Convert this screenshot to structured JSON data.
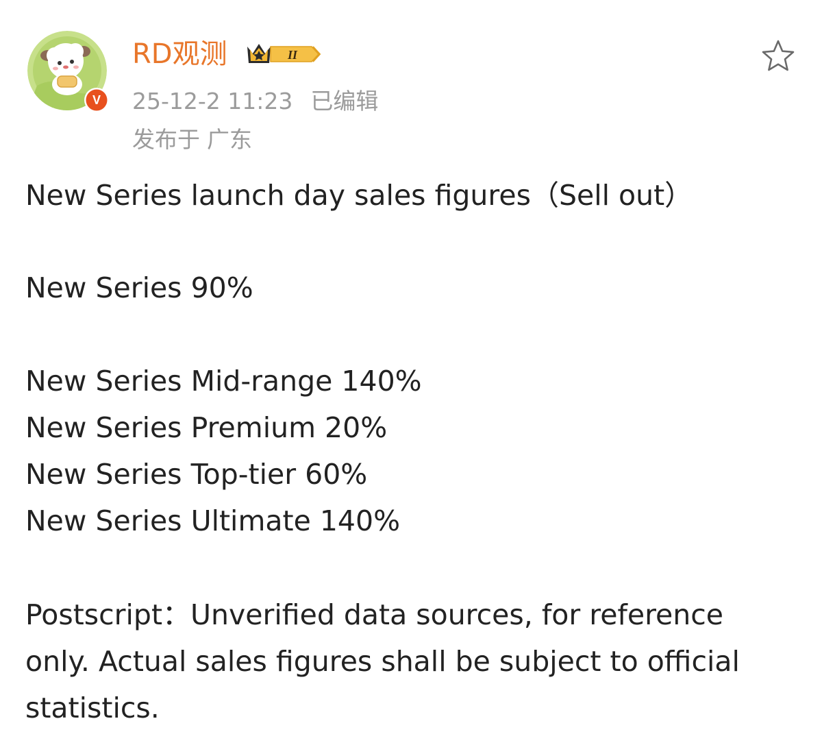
{
  "colors": {
    "username": "#e8762a",
    "meta": "#9b9b9b",
    "text": "#222222",
    "verified": "#e8501e",
    "badge_gold": "#f2b632"
  },
  "author": {
    "name": "RD观测",
    "avatar_icon": "sheep-avatar",
    "verified_icon": "verified-v-badge",
    "verified_letter": "V",
    "level_icon": "crown-level-badge",
    "level_label": "II"
  },
  "meta": {
    "timestamp": "25-12-2 11:23",
    "edited": "已编辑",
    "location_label": "发布于",
    "location_value": "广东"
  },
  "actions": {
    "favorite_icon": "star-outline-icon"
  },
  "content": {
    "headline": "New Series launch day sales figures（Sell out）",
    "overall": "New Series 90%",
    "items": [
      "New Series Mid-range 140%",
      "New Series Premium 20%",
      "New Series Top-tier 60%",
      "New Series Ultimate 140%"
    ],
    "postscript": [
      "Postscript：Unverified data sources, for reference",
      "only. Actual sales figures shall be subject to official",
      "statistics."
    ]
  }
}
